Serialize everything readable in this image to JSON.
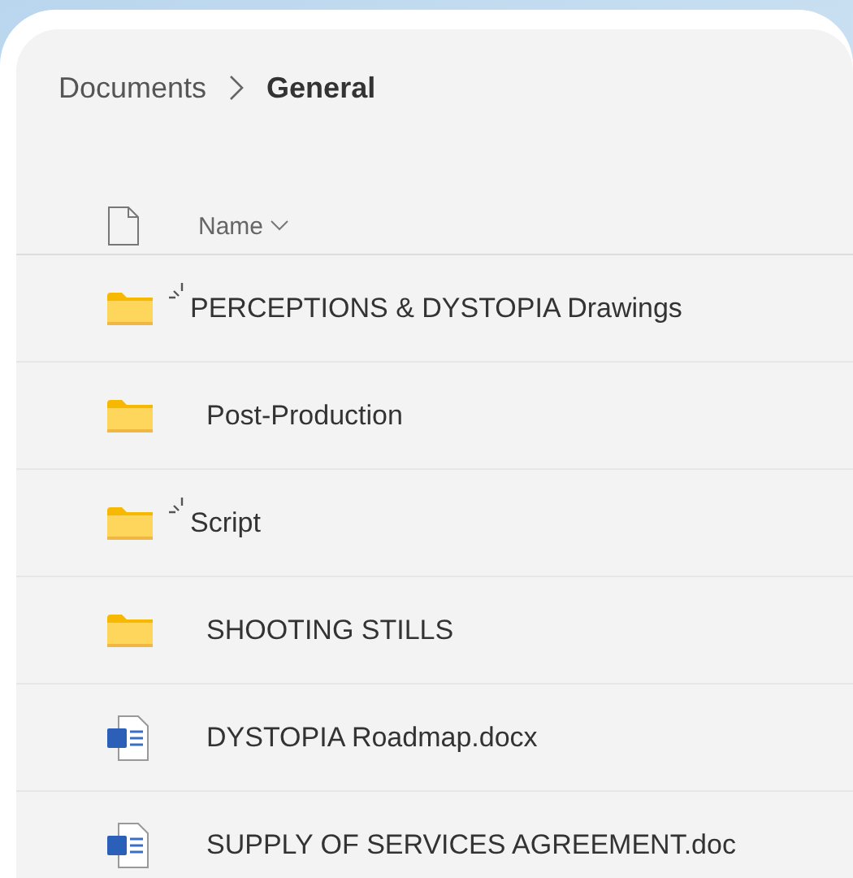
{
  "breadcrumb": {
    "parent": "Documents",
    "current": "General"
  },
  "column_header": {
    "label": "Name"
  },
  "files": [
    {
      "kind": "folder",
      "name": "PERCEPTIONS & DYSTOPIA Drawings",
      "new": true
    },
    {
      "kind": "folder",
      "name": "Post-Production",
      "new": false
    },
    {
      "kind": "folder",
      "name": "Script",
      "new": true
    },
    {
      "kind": "folder",
      "name": "SHOOTING STILLS",
      "new": false
    },
    {
      "kind": "word",
      "name": "DYSTOPIA Roadmap.docx",
      "new": false
    },
    {
      "kind": "word",
      "name": "SUPPLY OF SERVICES AGREEMENT.doc",
      "new": false
    }
  ]
}
